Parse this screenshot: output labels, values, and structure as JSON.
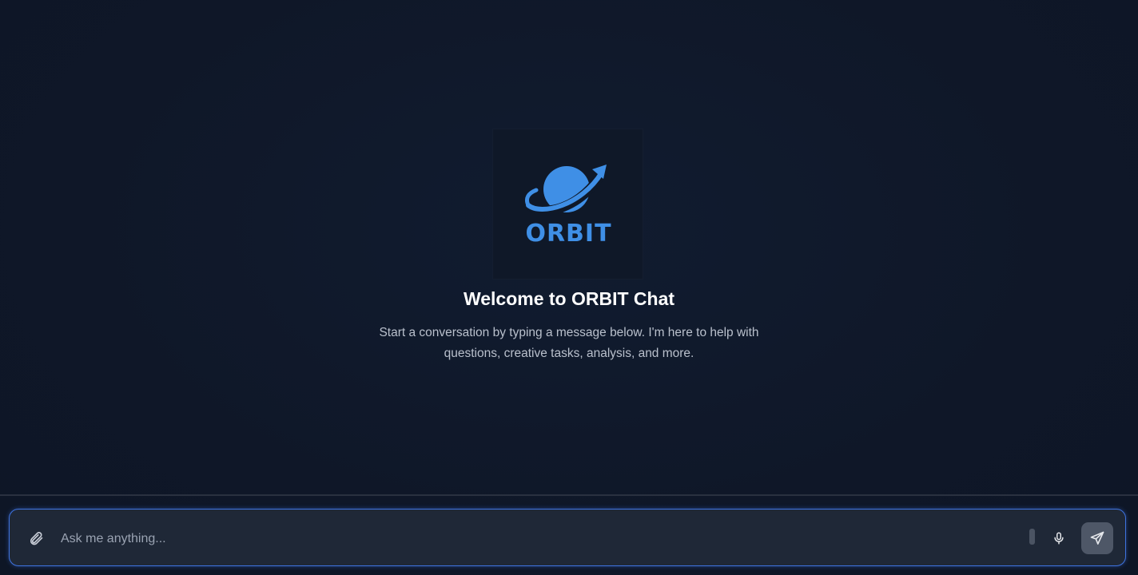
{
  "welcome": {
    "logo_text": "ORBIT",
    "title": "Welcome to ORBIT Chat",
    "subtitle": "Start a conversation by typing a message below. I'm here to help with questions, creative tasks, analysis, and more."
  },
  "composer": {
    "placeholder": "Ask me anything...",
    "value": ""
  },
  "icons": {
    "attach": "paperclip-icon",
    "mic": "microphone-icon",
    "send": "send-icon",
    "logo": "planet-orbit-logo"
  },
  "colors": {
    "background": "#101827",
    "accent": "#3e73e0",
    "logo_blue": "#3f8fe6",
    "composer_bg": "#1f2837",
    "send_button_bg": "#4e5767"
  }
}
